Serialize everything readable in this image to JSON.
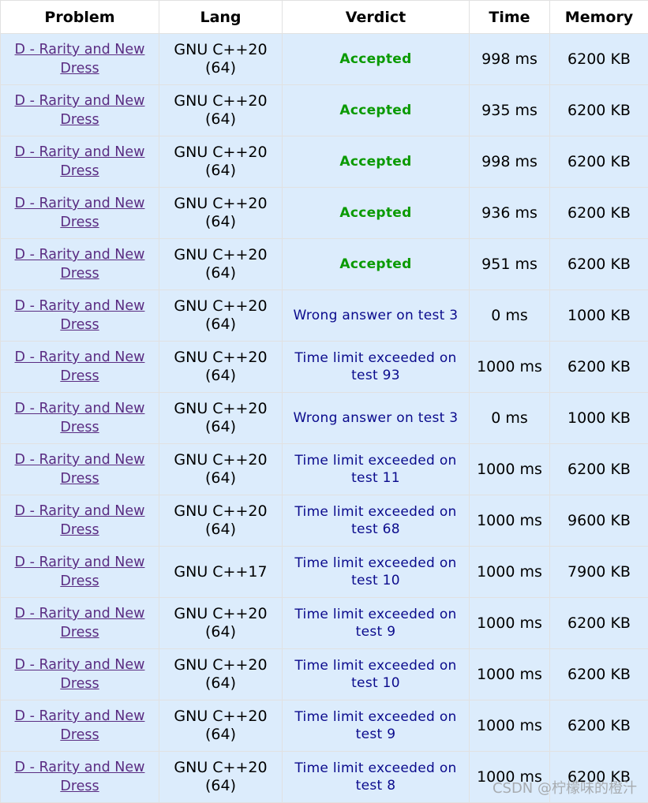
{
  "headers": [
    "Problem",
    "Lang",
    "Verdict",
    "Time",
    "Memory"
  ],
  "rows": [
    {
      "problem": "D - Rarity and New Dress",
      "lang": "GNU C++20 (64)",
      "verdict": "Accepted",
      "status": "accepted",
      "time": "998 ms",
      "memory": "6200 KB"
    },
    {
      "problem": "D - Rarity and New Dress",
      "lang": "GNU C++20 (64)",
      "verdict": "Accepted",
      "status": "accepted",
      "time": "935 ms",
      "memory": "6200 KB"
    },
    {
      "problem": "D - Rarity and New Dress",
      "lang": "GNU C++20 (64)",
      "verdict": "Accepted",
      "status": "accepted",
      "time": "998 ms",
      "memory": "6200 KB"
    },
    {
      "problem": "D - Rarity and New Dress",
      "lang": "GNU C++20 (64)",
      "verdict": "Accepted",
      "status": "accepted",
      "time": "936 ms",
      "memory": "6200 KB"
    },
    {
      "problem": "D - Rarity and New Dress",
      "lang": "GNU C++20 (64)",
      "verdict": "Accepted",
      "status": "accepted",
      "time": "951 ms",
      "memory": "6200 KB"
    },
    {
      "problem": "D - Rarity and New Dress",
      "lang": "GNU C++20 (64)",
      "verdict": "Wrong answer on test 3",
      "status": "rejected",
      "time": "0 ms",
      "memory": "1000 KB"
    },
    {
      "problem": "D - Rarity and New Dress",
      "lang": "GNU C++20 (64)",
      "verdict": "Time limit exceeded on test 93",
      "status": "rejected",
      "time": "1000 ms",
      "memory": "6200 KB"
    },
    {
      "problem": "D - Rarity and New Dress",
      "lang": "GNU C++20 (64)",
      "verdict": "Wrong answer on test 3",
      "status": "rejected",
      "time": "0 ms",
      "memory": "1000 KB"
    },
    {
      "problem": "D - Rarity and New Dress",
      "lang": "GNU C++20 (64)",
      "verdict": "Time limit exceeded on test 11",
      "status": "rejected",
      "time": "1000 ms",
      "memory": "6200 KB"
    },
    {
      "problem": "D - Rarity and New Dress",
      "lang": "GNU C++20 (64)",
      "verdict": "Time limit exceeded on test 68",
      "status": "rejected",
      "time": "1000 ms",
      "memory": "9600 KB"
    },
    {
      "problem": "D - Rarity and New Dress",
      "lang": "GNU C++17",
      "verdict": "Time limit exceeded on test 10",
      "status": "rejected",
      "time": "1000 ms",
      "memory": "7900 KB"
    },
    {
      "problem": "D - Rarity and New Dress",
      "lang": "GNU C++20 (64)",
      "verdict": "Time limit exceeded on test 9",
      "status": "rejected",
      "time": "1000 ms",
      "memory": "6200 KB"
    },
    {
      "problem": "D - Rarity and New Dress",
      "lang": "GNU C++20 (64)",
      "verdict": "Time limit exceeded on test 10",
      "status": "rejected",
      "time": "1000 ms",
      "memory": "6200 KB"
    },
    {
      "problem": "D - Rarity and New Dress",
      "lang": "GNU C++20 (64)",
      "verdict": "Time limit exceeded on test 9",
      "status": "rejected",
      "time": "1000 ms",
      "memory": "6200 KB"
    },
    {
      "problem": "D - Rarity and New Dress",
      "lang": "GNU C++20 (64)",
      "verdict": "Time limit exceeded on test 8",
      "status": "rejected",
      "time": "1000 ms",
      "memory": "6200 KB"
    }
  ],
  "colors": {
    "accepted": "#0a9a00",
    "rejected": "#0a0a8c",
    "link": "#5a2c82",
    "row_bg": "#dcecfc"
  },
  "watermark": "CSDN @柠檬味的橙汁"
}
